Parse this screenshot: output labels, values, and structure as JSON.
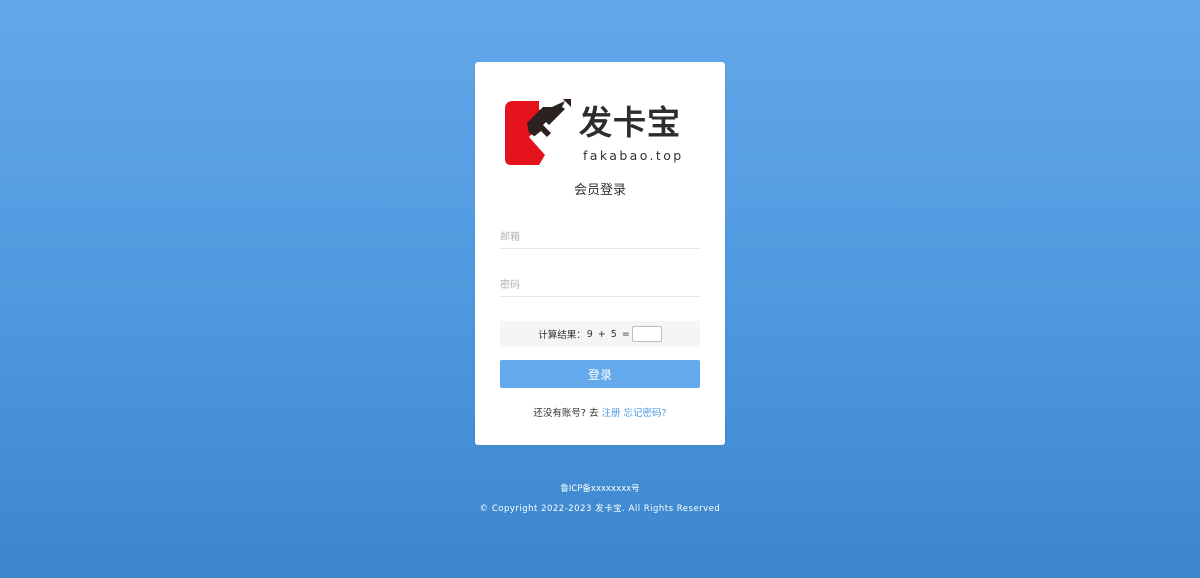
{
  "brand": {
    "name": "发卡宝",
    "domain": "fakabao.top",
    "logo_icon": "fakabao-logo-icon",
    "logo_red": "#e3121b",
    "logo_dark": "#2b2120"
  },
  "login": {
    "title": "会员登录",
    "email_placeholder": "邮箱",
    "password_placeholder": "密码",
    "captcha_label": "计算结果：",
    "captcha_expression": "9 + 5 =",
    "captcha_value": "",
    "submit_label": "登录",
    "no_account_text": "还没有账号? 去",
    "register_link": "注册",
    "forgot_link": "忘记密码?"
  },
  "footer": {
    "icp": "鲁ICP备xxxxxxxx号",
    "copyright": "© Copyright 2022-2023 发卡宝. All Rights Reserved"
  },
  "colors": {
    "background_top": "#63a7ea",
    "background_bottom": "#3b86cd",
    "button": "#64a9ec",
    "link": "#4e9be6"
  }
}
